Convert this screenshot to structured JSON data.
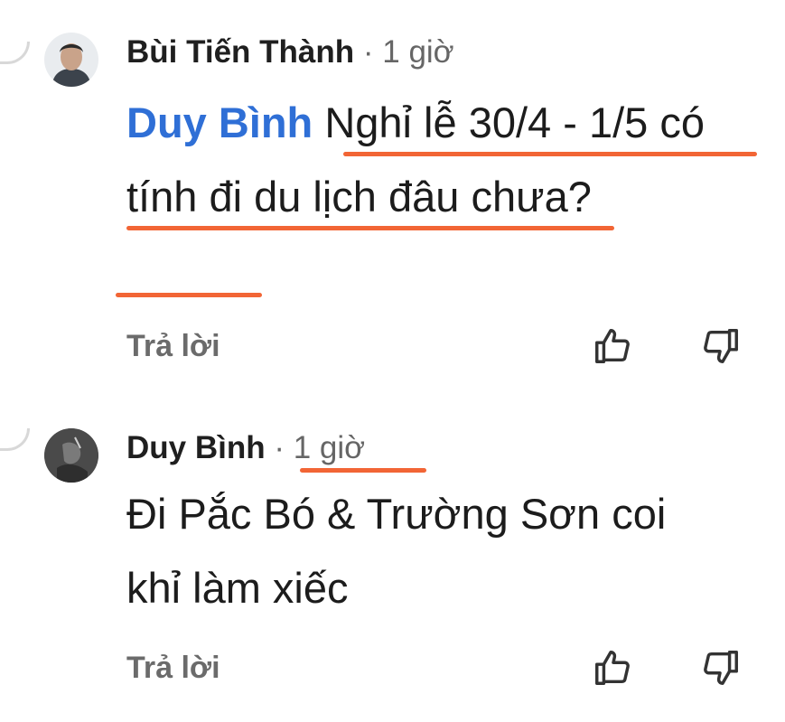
{
  "comments": [
    {
      "author": "Bùi Tiến Thành",
      "time": "· 1 giờ",
      "mention": "Duy Bình",
      "text": " Nghỉ lễ 30/4 - 1/5 có tính đi du lịch đâu chưa?",
      "reply_label": "Trả lời"
    },
    {
      "author": "Duy Bình",
      "time": "· 1 giờ",
      "text": "Đi Pắc Bó & Trường Sơn coi khỉ làm xiếc",
      "reply_label": "Trả lời"
    }
  ],
  "icons": {
    "like": "thumbs-up-icon",
    "dislike": "thumbs-down-icon"
  },
  "colors": {
    "mention": "#2f6fd6",
    "annotation": "#f26535",
    "muted": "#6b6b6b"
  }
}
